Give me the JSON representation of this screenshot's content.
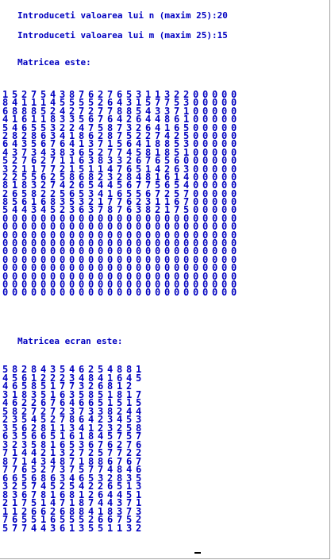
{
  "console": {
    "prompt_n": "Introduceti valoarea lui n (maxim 25):20",
    "prompt_m": "Introduceti valoarea lui m (maxim 25):15",
    "matrix_title": "Matricea este:",
    "screen_matrix_title": "Matricea ecran este:",
    "matrix_rows": [
      "1 5 2 7 5 4 3 8 7 6 2 7 6 5 3 1 1 3 2 2 0 0 0 0 0",
      "8 4 1 1 1 4 5 5 5 5 2 6 4 3 1 5 7 7 5 3 0 0 0 0 0",
      "6 8 8 8 5 2 4 2 7 2 7 7 8 8 5 4 3 3 7 1 0 0 0 0 0",
      "4 1 6 1 1 8 3 3 5 6 7 6 4 2 6 4 4 8 6 1 0 0 0 0 0",
      "5 4 6 5 5 3 2 2 4 7 5 8 7 3 2 6 4 1 6 5 0 0 0 0 0",
      "2 8 2 8 6 3 4 1 8 6 2 8 7 5 2 2 7 4 2 5 0 0 0 0 0",
      "6 4 3 5 6 7 6 4 1 3 7 1 5 6 4 1 8 8 5 3 0 0 0 0 0",
      "4 3 7 3 4 3 8 3 6 5 2 7 7 4 5 8 1 8 5 1 0 0 0 0 0",
      "5 2 7 6 2 7 1 1 6 3 8 3 3 2 6 7 6 5 6 0 0 0 0 0 0",
      "3 2 1 1 7 7 2 1 5 1 1 4 7 6 5 1 4 2 6 3 0 0 0 0 0",
      "2 2 5 5 6 2 5 8 6 8 2 3 2 8 4 8 1 6 1 4 0 0 0 0 0",
      "8 1 8 3 2 7 4 2 6 5 4 4 5 6 7 7 5 6 5 4 0 0 0 0 0",
      "2 6 5 8 2 2 5 6 5 3 4 1 6 5 5 6 7 2 5 7 0 0 0 0 0",
      "8 5 6 1 6 8 3 5 3 2 1 7 7 6 2 3 1 1 6 7 0 0 0 0 0",
      "5 4 4 3 4 5 2 3 6 3 7 8 7 6 3 8 2 1 7 5 0 0 0 0 0",
      "0 0 0 0 0 0 0 0 0 0 0 0 0 0 0 0 0 0 0 0 0 0 0 0 0",
      "0 0 0 0 0 0 0 0 0 0 0 0 0 0 0 0 0 0 0 0 0 0 0 0 0",
      "0 0 0 0 0 0 0 0 0 0 0 0 0 0 0 0 0 0 0 0 0 0 0 0 0",
      "0 0 0 0 0 0 0 0 0 0 0 0 0 0 0 0 0 0 0 0 0 0 0 0 0",
      "0 0 0 0 0 0 0 0 0 0 0 0 0 0 0 0 0 0 0 0 0 0 0 0 0",
      "0 0 0 0 0 0 0 0 0 0 0 0 0 0 0 0 0 0 0 0 0 0 0 0 0",
      "0 0 0 0 0 0 0 0 0 0 0 0 0 0 0 0 0 0 0 0 0 0 0 0 0",
      "0 0 0 0 0 0 0 0 0 0 0 0 0 0 0 0 0 0 0 0 0 0 0 0 0",
      "0 0 0 0 0 0 0 0 0 0 0 0 0 0 0 0 0 0 0 0 0 0 0 0 0",
      "0 0 0 0 0 0 0 0 0 0 0 0 0 0 0 0 0 0 0 0 0 0 0 0 0"
    ],
    "screen_matrix_rows": [
      "5 8 2 8 4 3 5 4 6 2 5 4 8 8 1",
      "4 5 6 1 2 2 2 3 4 8 4 1 6 4 5",
      "4 6 5 8 5 1 7 7 3 2 6 8 1 2",
      "3 1 8 3 5 1 6 3 5 8 5 1 8 1 7",
      "4 6 2 2 6 7 6 4 6 6 5 1 5 1 5",
      "5 8 2 7 2 7 2 3 7 3 3 8 2 4 4",
      "2 3 5 4 5 2 7 8 6 4 2 3 4 5 3",
      "3 5 6 2 8 1 1 3 4 1 2 3 2 5 8",
      "6 3 5 6 6 5 1 6 1 8 4 5 7 5 7",
      "3 2 3 5 8 1 6 5 3 6 7 6 2 7 6",
      "7 1 4 4 2 1 3 2 7 2 5 7 7 2 2",
      "8 7 1 4 3 4 8 7 1 8 8 6 7 6 7",
      "7 7 6 5 2 7 3 7 5 7 7 4 8 4 6",
      "6 6 5 6 8 6 3 4 6 5 3 2 8 3 5",
      "3 2 5 7 4 5 2 5 4 2 2 6 5 1 3",
      "8 3 6 7 8 1 6 8 1 2 6 4 4 5 1",
      "2 1 7 5 1 4 7 1 8 7 4 4 3 7 1",
      "1 1 2 6 6 2 6 8 8 4 1 8 3 7 3",
      "7 6 5 5 1 6 5 5 5 2 6 6 7 5 2",
      "5 7 7 4 4 3 6 1 3 5 5 1 1 3 2"
    ]
  }
}
